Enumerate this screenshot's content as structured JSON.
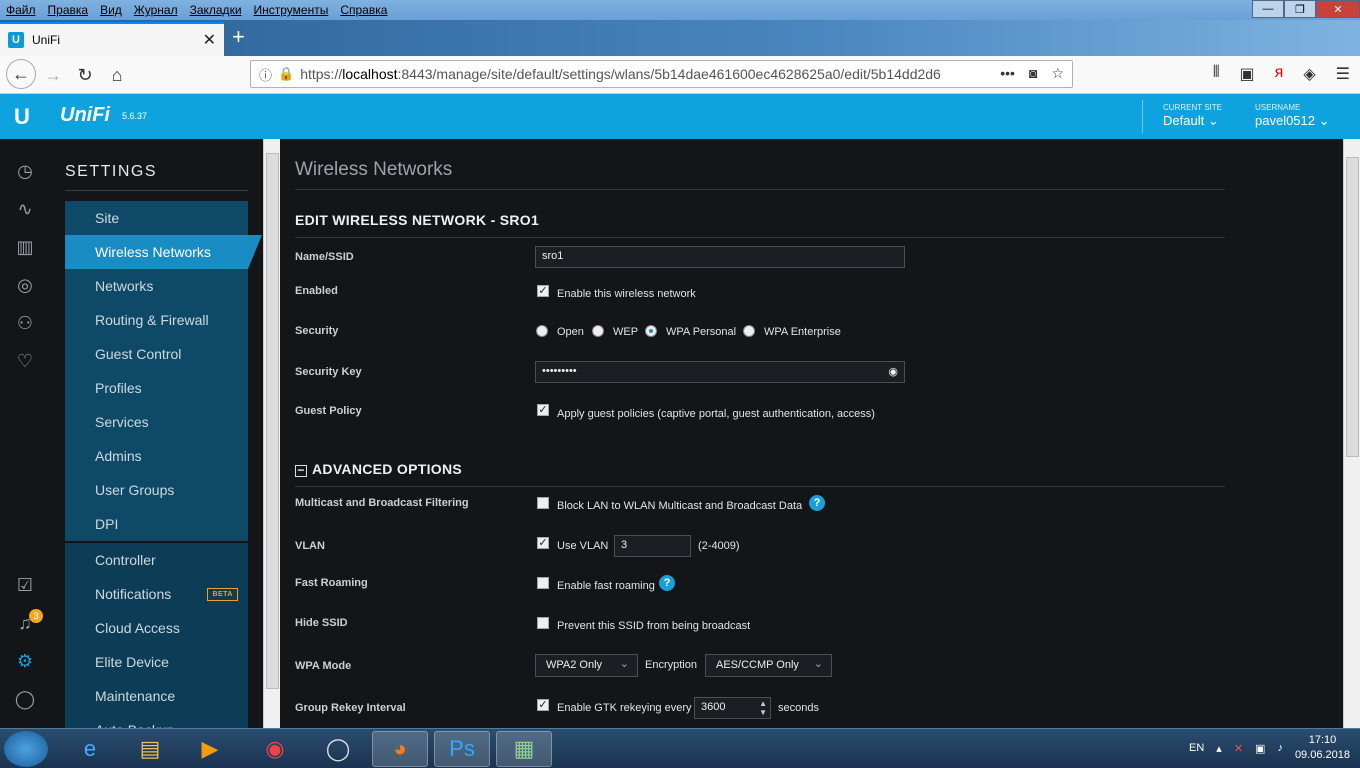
{
  "browser": {
    "menu": [
      "Файл",
      "Правка",
      "Вид",
      "Журнал",
      "Закладки",
      "Инструменты",
      "Справка"
    ],
    "tab_title": "UniFi",
    "url_prefix": "https://",
    "url_host": "localhost",
    "url_rest": ":8443/manage/site/default/settings/wlans/5b14dae461600ec4628625a0/edit/5b14dd2d6",
    "window_buttons": {
      "min": "—",
      "max": "❐",
      "close": "✕"
    }
  },
  "header": {
    "brand": "UniFi",
    "version": "5.6.37",
    "current_site_label": "CURRENT SITE",
    "current_site": "Default",
    "username_label": "USERNAME",
    "username": "pavel0512"
  },
  "notifications_badge": "3",
  "settings": {
    "heading": "SETTINGS",
    "items": [
      "Site",
      "Wireless Networks",
      "Networks",
      "Routing & Firewall",
      "Guest Control",
      "Profiles",
      "Services",
      "Admins",
      "User Groups",
      "DPI"
    ],
    "items2": [
      "Controller",
      "Notifications",
      "Cloud Access",
      "Elite Device",
      "Maintenance",
      "Auto Backup"
    ],
    "beta": "BETA"
  },
  "page": {
    "title": "Wireless Networks",
    "section": "EDIT WIRELESS NETWORK - SRO1",
    "name_label": "Name/SSID",
    "name_value": "sro1",
    "enabled_label": "Enabled",
    "enabled_text": "Enable this wireless network",
    "security_label": "Security",
    "security_options": [
      "Open",
      "WEP",
      "WPA Personal",
      "WPA Enterprise"
    ],
    "security_selected": "WPA Personal",
    "key_label": "Security Key",
    "key_value": "•••••••••",
    "guest_label": "Guest Policy",
    "guest_text": "Apply guest policies (captive portal, guest authentication, access)",
    "advanced": "ADVANCED OPTIONS",
    "multicast_label": "Multicast and Broadcast Filtering",
    "multicast_text": "Block LAN to WLAN Multicast and Broadcast Data",
    "vlan_label": "VLAN",
    "vlan_text": "Use VLAN",
    "vlan_value": "3",
    "vlan_range": "(2-4009)",
    "roaming_label": "Fast Roaming",
    "roaming_text": "Enable fast roaming",
    "hide_label": "Hide SSID",
    "hide_text": "Prevent this SSID from being broadcast",
    "wpa_label": "WPA Mode",
    "wpa_value": "WPA2 Only",
    "enc_label": "Encryption",
    "enc_value": "AES/CCMP Only",
    "rekey_label": "Group Rekey Interval",
    "rekey_text": "Enable GTK rekeying every",
    "rekey_value": "3600",
    "rekey_unit": "seconds"
  },
  "taskbar": {
    "lang": "EN",
    "time": "17:10",
    "date": "09.06.2018"
  }
}
